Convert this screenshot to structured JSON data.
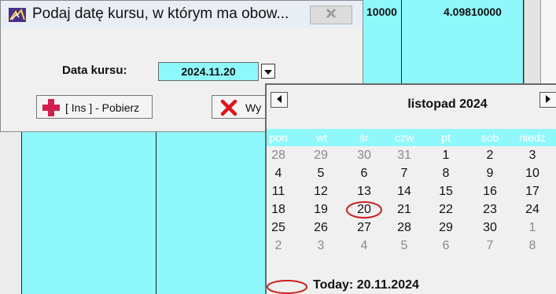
{
  "colors": {
    "cyan": "#8ff8fb",
    "dialog_bg": "#f0f0f0",
    "titlebar": "#e9eef5",
    "circle": "#cc1f1f"
  },
  "background": {
    "cells": [
      "10000",
      "4.09810000"
    ]
  },
  "dialog": {
    "title": "Podaj datę kursu, w którym ma obow...",
    "date_label": "Data kursu:",
    "date_value": "2024.11.20",
    "ins_button_label": "[ Ins ] - Pobierz",
    "exit_button_label": "Wy"
  },
  "calendar": {
    "month_title": "listopad 2024",
    "weekdays": [
      "pon",
      "wt",
      "śr",
      "czw",
      "pt",
      "sob",
      "niedz"
    ],
    "weeks": [
      [
        "28",
        "29",
        "30",
        "31",
        "1",
        "2",
        "3"
      ],
      [
        "4",
        "5",
        "6",
        "7",
        "8",
        "9",
        "10"
      ],
      [
        "11",
        "12",
        "13",
        "14",
        "15",
        "16",
        "17"
      ],
      [
        "18",
        "19",
        "20",
        "21",
        "22",
        "23",
        "24"
      ],
      [
        "25",
        "26",
        "27",
        "28",
        "29",
        "30",
        "1"
      ],
      [
        "2",
        "3",
        "4",
        "5",
        "6",
        "7",
        "8"
      ]
    ],
    "today_label": "Today: 20.11.2024"
  }
}
